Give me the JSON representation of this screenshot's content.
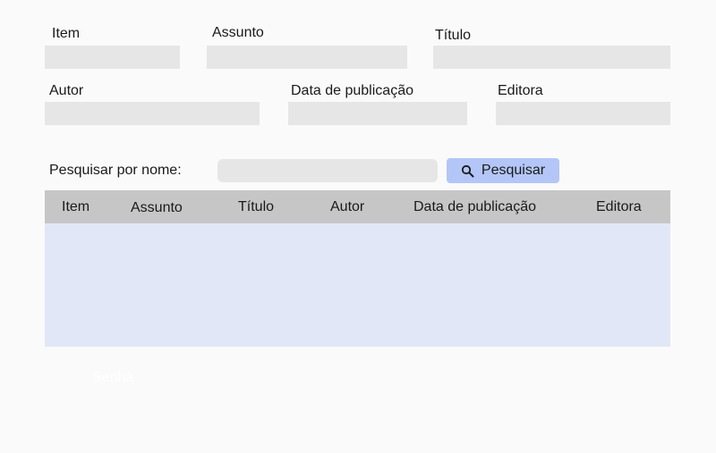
{
  "form": {
    "item_label": "Item",
    "assunto_label": "Assunto",
    "titulo_label": "Título",
    "autor_label": "Autor",
    "data_label": "Data de publicação",
    "editora_label": "Editora",
    "item_value": "",
    "assunto_value": "",
    "titulo_value": "",
    "autor_value": "",
    "data_value": "",
    "editora_value": ""
  },
  "search": {
    "label": "Pesquisar por nome:",
    "value": "",
    "button_label": "Pesquisar",
    "button_icon": "search-icon"
  },
  "table": {
    "columns": [
      "Item",
      "Assunto",
      "Título",
      "Autor",
      "Data de publicação",
      "Editora"
    ],
    "rows": []
  },
  "ghost_text": "Senha",
  "colors": {
    "field_bg": "#e6e6e6",
    "button_bg": "#b4c6f7",
    "table_header_bg": "#c6c6c6",
    "table_body_bg": "#e1e7f6",
    "page_bg": "#fafafa"
  }
}
